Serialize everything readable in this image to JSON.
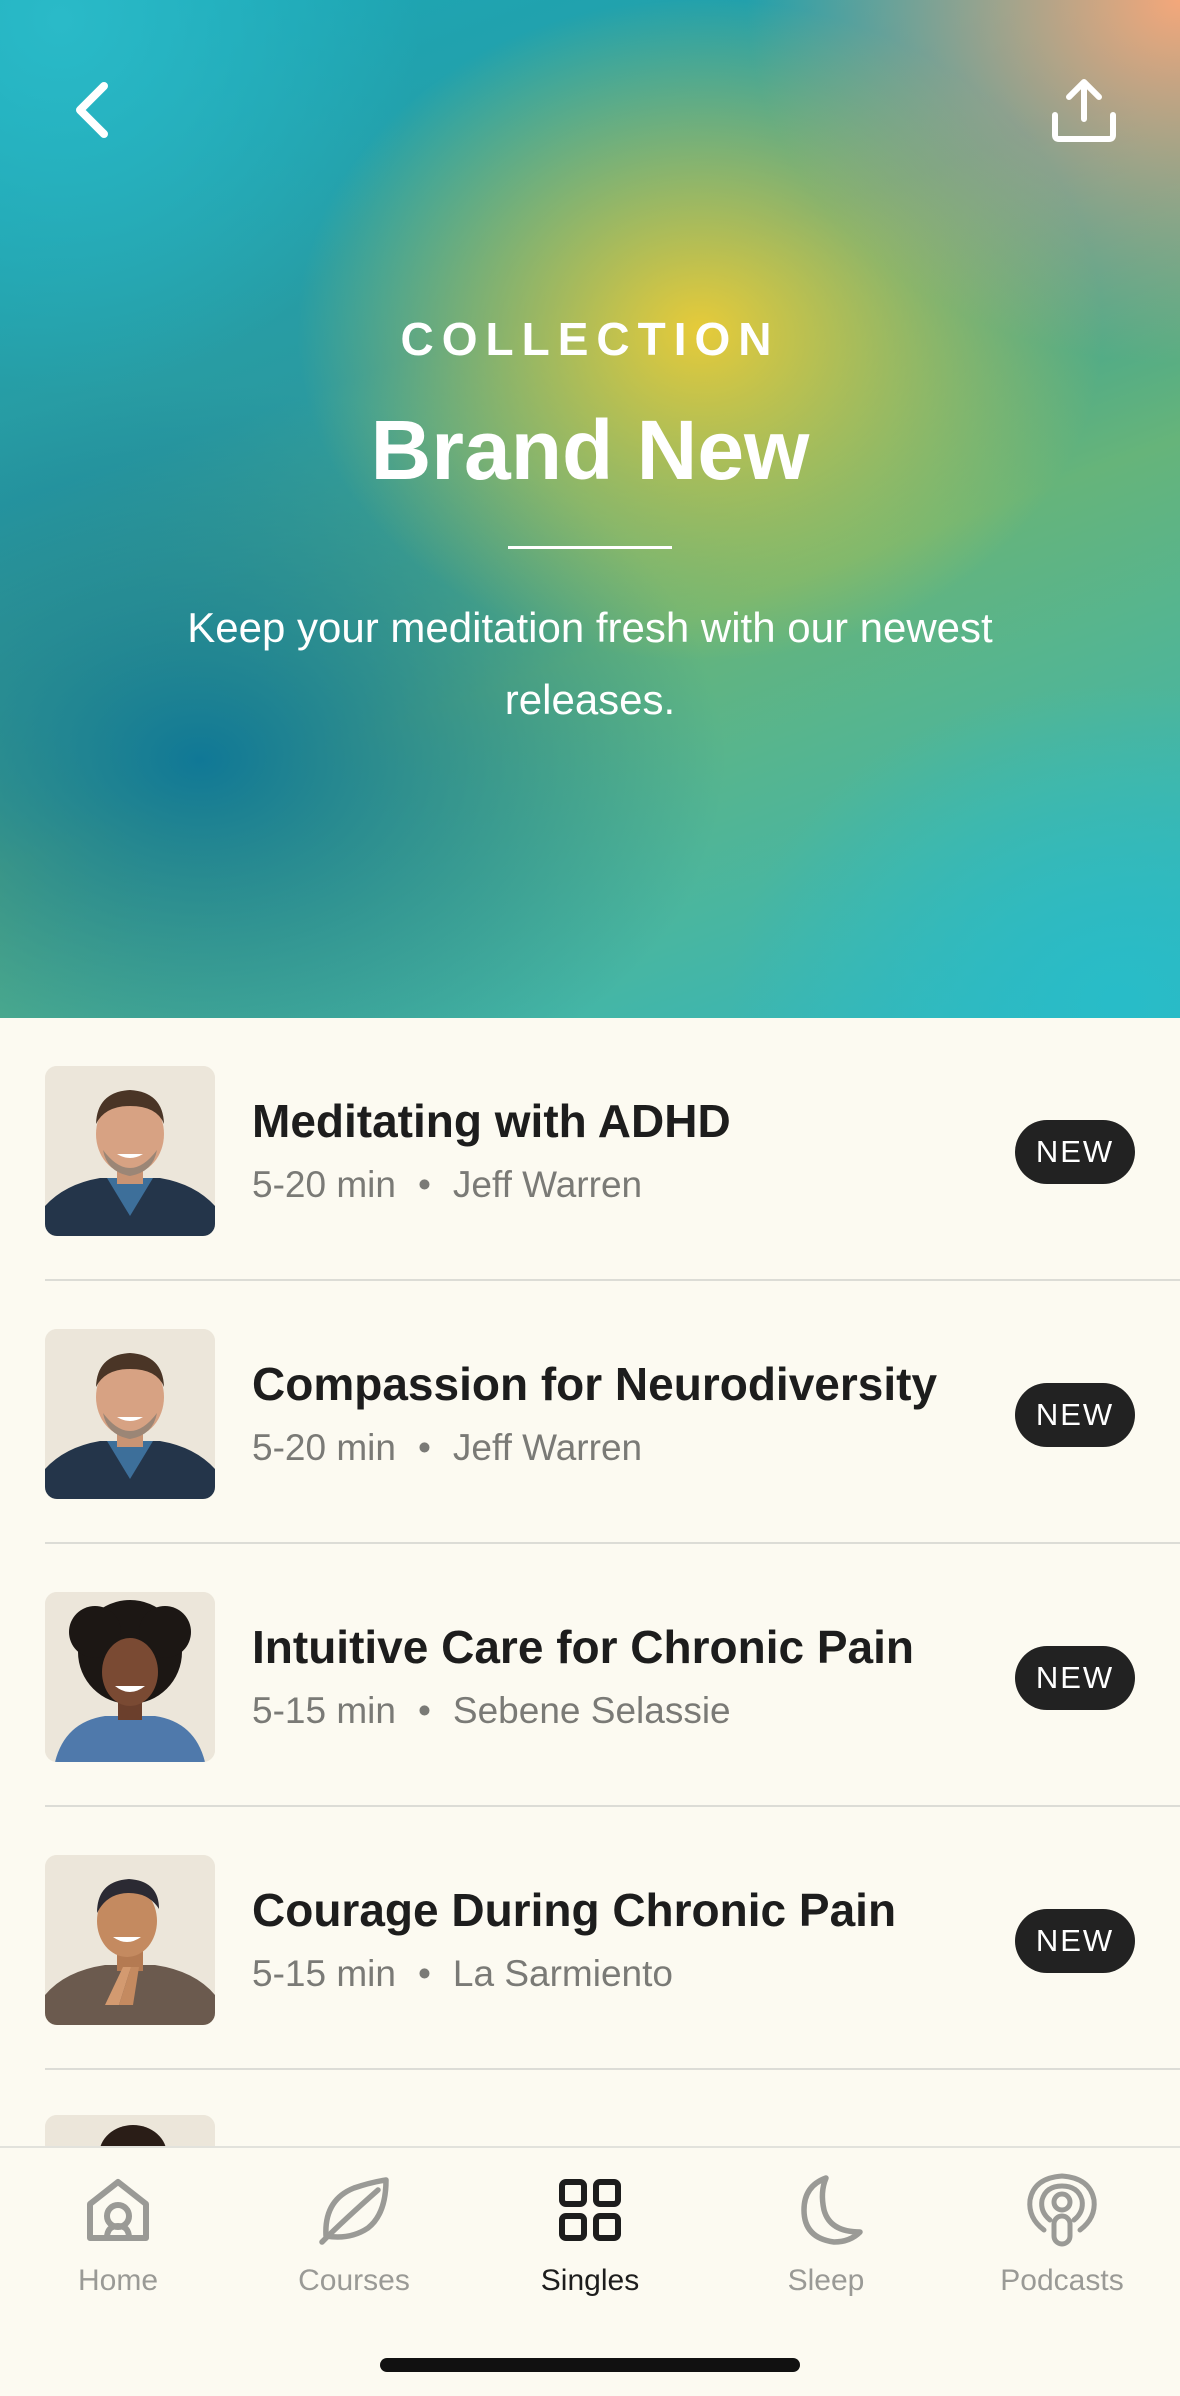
{
  "header": {
    "eyebrow": "COLLECTION",
    "title": "Brand New",
    "description": "Keep your meditation fresh with our newest releases."
  },
  "items": [
    {
      "title": "Meditating with ADHD",
      "duration": "5-20 min",
      "author": "Jeff Warren",
      "badge": "NEW"
    },
    {
      "title": "Compassion for Neurodiversity",
      "duration": "5-20 min",
      "author": "Jeff Warren",
      "badge": "NEW"
    },
    {
      "title": "Intuitive Care for Chronic Pain",
      "duration": "5-15 min",
      "author": "Sebene Selassie",
      "badge": "NEW"
    },
    {
      "title": "Courage During Chronic Pain",
      "duration": "5-15 min",
      "author": "La Sarmiento",
      "badge": "NEW"
    }
  ],
  "meta_separator": "•",
  "tabs": [
    {
      "label": "Home",
      "icon": "home-icon",
      "active": false
    },
    {
      "label": "Courses",
      "icon": "leaf-icon",
      "active": false
    },
    {
      "label": "Singles",
      "icon": "grid-icon",
      "active": true
    },
    {
      "label": "Sleep",
      "icon": "moon-icon",
      "active": false
    },
    {
      "label": "Podcasts",
      "icon": "podcast-icon",
      "active": false
    }
  ],
  "colors": {
    "background": "#fcfaf1",
    "badge": "#222222",
    "active_tab": "#1d1d1d",
    "inactive_tab": "#9a9a96"
  }
}
